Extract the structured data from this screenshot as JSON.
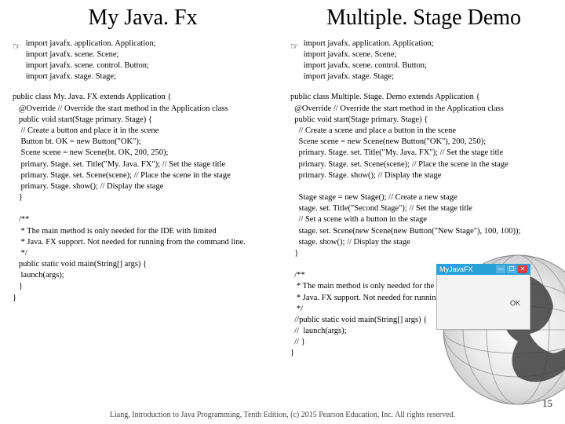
{
  "left": {
    "title": "My Java. Fx",
    "bullet": "☞",
    "imports": "import javafx. application. Application;\nimport javafx. scene. Scene;\nimport javafx. scene. control. Button;\nimport javafx. stage. Stage;",
    "code": "public class My. Java. FX extends Application {\n   @Override // Override the start method in the Application class\n   public void start(Stage primary. Stage) {\n    // Create a button and place it in the scene\n    Button bt. OK = new Button(\"OK\");\n    Scene scene = new Scene(bt. OK, 200, 250);\n    primary. Stage. set. Title(\"My. Java. FX\"); // Set the stage title\n    primary. Stage. set. Scene(scene); // Place the scene in the stage\n    primary. Stage. show(); // Display the stage\n   }\n\n   /**\n    * The main method is only needed for the IDE with limited\n    * Java. FX support. Not needed for running from the command line.\n    */\n   public static void main(String[] args) {\n    launch(args);\n   }\n}"
  },
  "right": {
    "title": "Multiple. Stage Demo",
    "bullet": "☞",
    "imports": "import javafx. application. Application;\nimport javafx. scene. Scene;\nimport javafx. scene. control. Button;\nimport javafx. stage. Stage;",
    "code": "public class Multiple. Stage. Demo extends Application {\n  @Override // Override the start method in the Application class\n  public void start(Stage primary. Stage) {\n    // Create a scene and place a button in the scene\n    Scene scene = new Scene(new Button(\"OK\"), 200, 250);\n    primary. Stage. set. Title(\"My. Java. FX\"); // Set the stage title\n    primary. Stage. set. Scene(scene); // Place the scene in the stage\n    primary. Stage. show(); // Display the stage\n\n    Stage stage = new Stage(); // Create a new stage\n    stage. set. Title(\"Second Stage\"); // Set the stage title\n    // Set a scene with a button in the stage\n    stage. set. Scene(new Scene(new Button(\"New Stage\"), 100, 100));\n    stage. show(); // Display the stage\n  }\n\n  /**\n   * The main method is only needed for the IDE with limited\n   * Java. FX support. Not needed for running from the command line.\n   */\n  //public static void main(String[] args) {\n  //  launch(args);\n  // }\n}"
  },
  "window": {
    "title": "MyJavaFX",
    "min": "—",
    "max": "☐",
    "close": "✕",
    "ok": "OK"
  },
  "footer": "Liang, Introduction to Java Programming, Tenth Edition, (c) 2015 Pearson Education, Inc. All rights reserved.",
  "page": "15"
}
